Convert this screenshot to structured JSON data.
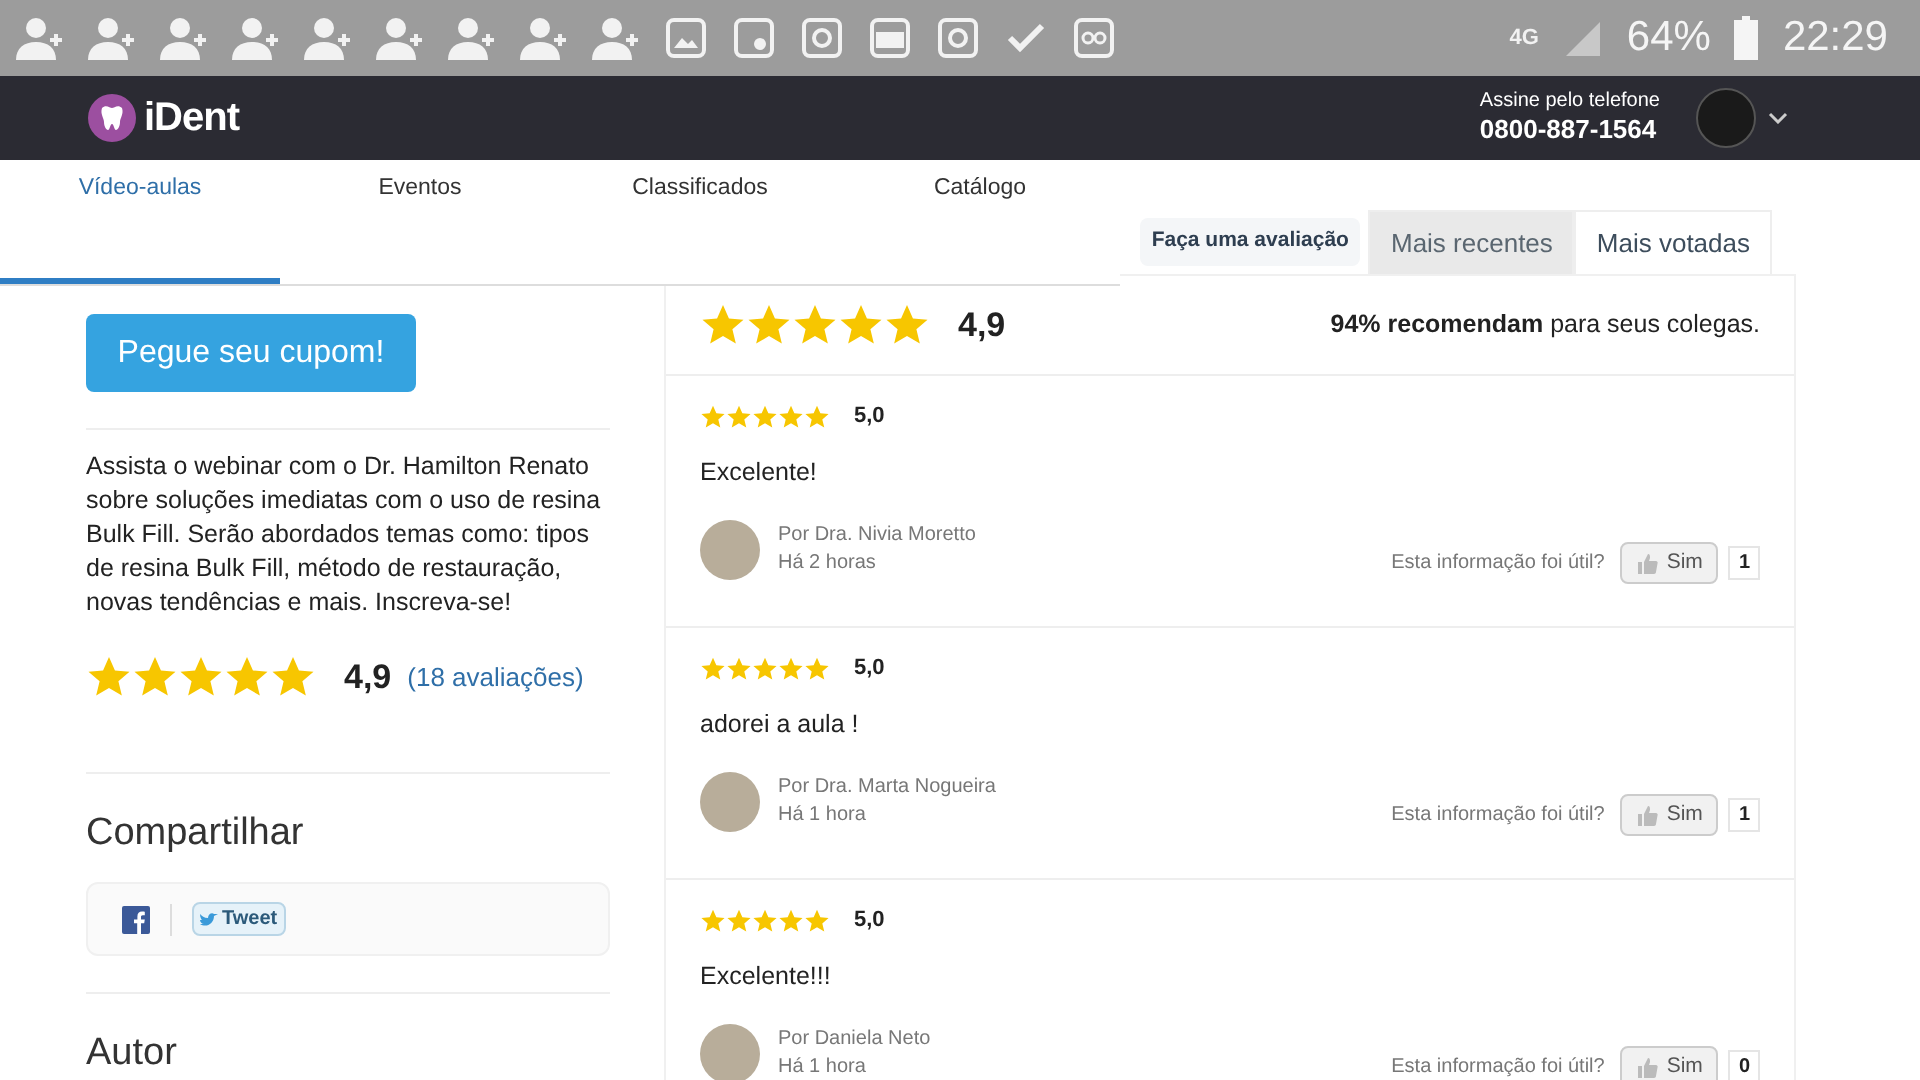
{
  "status_bar": {
    "network": "4G",
    "battery": "64%",
    "time": "22:29"
  },
  "header": {
    "logo": "iDent",
    "phone_label": "Assine pelo telefone",
    "phone": "0800-887-1564"
  },
  "menu": [
    {
      "label": "Vídeo-aulas",
      "selected": true
    },
    {
      "label": "Eventos",
      "selected": false
    },
    {
      "label": "Classificados",
      "selected": false
    },
    {
      "label": "Catálogo",
      "selected": false
    }
  ],
  "sidebar": {
    "coupon_button": "Pegue seu cupom!",
    "description": "Assista o webinar com o Dr. Hamilton Renato sobre soluções imediatas com o uso de resina Bulk Fill. Serão abordados temas como: tipos de resina Bulk Fill, método de restauração, novas tendências e mais. Inscreva-se!",
    "rating": {
      "stars": 5,
      "score": "4,9",
      "count": "(18 avaliações)"
    },
    "share_title": "Compartilhar",
    "tweet_button": "Tweet",
    "author_title": "Autor"
  },
  "reviews_panel": {
    "tabs": [
      {
        "label": "Faça uma avaliação",
        "kind": "action",
        "selected": false
      },
      {
        "label": "Mais recentes",
        "kind": "tab",
        "selected": false
      },
      {
        "label": "Mais votadas",
        "kind": "tab",
        "selected": true
      }
    ],
    "summary": {
      "stars": 5,
      "score": "4,9",
      "recommend": "**94% recomendam** para seus colegas."
    },
    "reviews": [
      {
        "stars": 5,
        "score": "5,0",
        "text": "Excelente!",
        "author": "Por Dra. Nivia Moretto",
        "time": "Há 2 horas",
        "helpful_label": "Esta informação foi útil?",
        "button": "Sim",
        "count": "1"
      },
      {
        "stars": 5,
        "score": "5,0",
        "text": "adorei a aula !",
        "author": "Por Dra. Marta Nogueira",
        "time": "Há 1 hora",
        "helpful_label": "Esta informação foi útil?",
        "button": "Sim",
        "count": "1"
      },
      {
        "stars": 5,
        "score": "5,0",
        "text": "Excelente!!!",
        "author": "Por Daniela Neto",
        "time": "Há 1 hora",
        "helpful_label": "Esta informação foi útil?",
        "button": "Sim",
        "count": "0"
      }
    ]
  }
}
